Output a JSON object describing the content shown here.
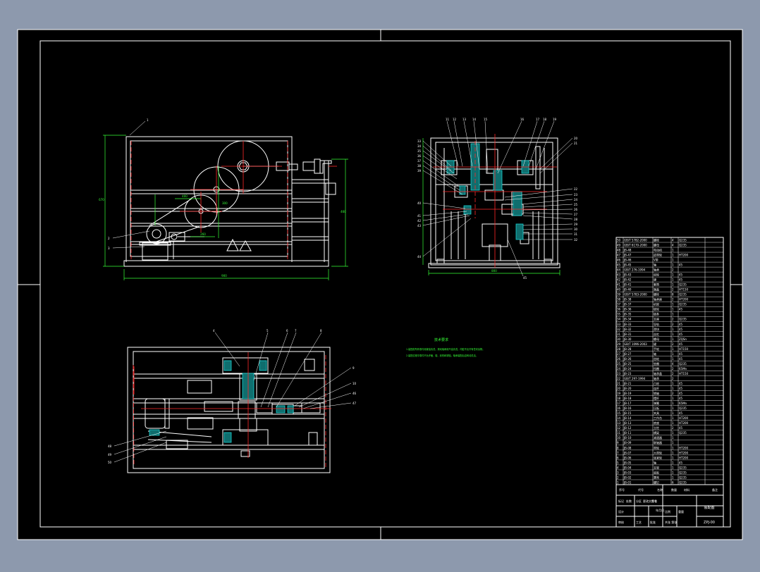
{
  "colors": {
    "background": "#8d99ad",
    "sheet": "#000000",
    "outline": "#ffffff",
    "dimension": "#37ff37",
    "centerline": "#ff2a2a",
    "section": "#19d3d3"
  },
  "front_view": {
    "overall_width": "900",
    "overall_height": "670",
    "side_height": "460",
    "dim_a": "400",
    "dim_b": "260",
    "dim_c": "300",
    "balloons": [
      "1",
      "2",
      "3"
    ]
  },
  "side_view": {
    "overall_width": "800",
    "top_balloons": [
      "11",
      "12",
      "13",
      "14",
      "15",
      "16",
      "17",
      "18",
      "19"
    ],
    "right_balloons": [
      "20",
      "21",
      "22",
      "23",
      "24",
      "25",
      "26",
      "27",
      "28",
      "29",
      "30",
      "31",
      "32"
    ],
    "left_balloons": [
      "33",
      "34",
      "35",
      "36",
      "37",
      "38",
      "39",
      "40",
      "41",
      "42",
      "43",
      "44"
    ],
    "bottom_balloon": "45"
  },
  "top_view": {
    "top_balloons": [
      "4",
      "5",
      "6",
      "7",
      "8"
    ],
    "right_balloons": [
      "9",
      "10",
      "46",
      "47"
    ],
    "left_balloons": [
      "48",
      "49",
      "50"
    ]
  },
  "technical_requirements": {
    "title": "技术要求",
    "line1": "1.装配前所有零件用煤油清洗，滚动轴承用汽油清洗，内腔不允许有任何杂物。",
    "line2": "2.装配过程中零件不允许磕、碰、划伤和锈蚀，轴承装配后应转动灵活。"
  },
  "bom": {
    "headers": [
      "序号",
      "代号",
      "名称",
      "数量",
      "材料",
      "备注"
    ],
    "rows": [
      [
        "50",
        "GB/T 5782-2000",
        "螺栓",
        "4",
        "Q235",
        ""
      ],
      [
        "49",
        "GB/T 6170-2000",
        "螺母",
        "4",
        "Q235",
        ""
      ],
      [
        "48",
        "JB-48",
        "电动机",
        "1",
        "",
        ""
      ],
      [
        "47",
        "JB-47",
        "皮带轮",
        "1",
        "HT200",
        ""
      ],
      [
        "46",
        "JB-46",
        "V带",
        "1",
        "",
        ""
      ],
      [
        "45",
        "JB-45",
        "轴",
        "1",
        "45",
        ""
      ],
      [
        "44",
        "GB/T 276-1994",
        "轴承",
        "2",
        "",
        ""
      ],
      [
        "43",
        "JB-43",
        "齿轮",
        "1",
        "45",
        ""
      ],
      [
        "42",
        "JB-42",
        "键",
        "1",
        "45",
        ""
      ],
      [
        "41",
        "JB-41",
        "套筒",
        "1",
        "Q235",
        ""
      ],
      [
        "40",
        "JB-40",
        "端盖",
        "2",
        "HT150",
        ""
      ],
      [
        "39",
        "GB/T 5783-2000",
        "螺栓",
        "8",
        "Q235",
        ""
      ],
      [
        "38",
        "JB-38",
        "轴承座",
        "2",
        "HT200",
        ""
      ],
      [
        "37",
        "JB-37",
        "机架",
        "1",
        "Q235",
        ""
      ],
      [
        "36",
        "JB-36",
        "链轮",
        "1",
        "45",
        ""
      ],
      [
        "35",
        "JB-35",
        "链条",
        "1",
        "",
        ""
      ],
      [
        "34",
        "JB-34",
        "支座",
        "2",
        "Q235",
        ""
      ],
      [
        "33",
        "JB-33",
        "导轨",
        "2",
        "45",
        ""
      ],
      [
        "32",
        "JB-32",
        "滑块",
        "1",
        "45",
        ""
      ],
      [
        "31",
        "JB-31",
        "丝杠",
        "1",
        "45",
        ""
      ],
      [
        "30",
        "JB-30",
        "螺母",
        "1",
        "ZQSn",
        ""
      ],
      [
        "29",
        "GB/T 1096-2003",
        "键",
        "2",
        "45",
        ""
      ],
      [
        "28",
        "JB-28",
        "手轮",
        "1",
        "HT150",
        ""
      ],
      [
        "27",
        "JB-27",
        "轴",
        "1",
        "45",
        ""
      ],
      [
        "26",
        "JB-26",
        "齿轮",
        "1",
        "45",
        ""
      ],
      [
        "25",
        "JB-25",
        "垫圈",
        "4",
        "Q235",
        ""
      ],
      [
        "24",
        "JB-24",
        "挡圈",
        "2",
        "65Mn",
        ""
      ],
      [
        "23",
        "JB-23",
        "轴承盖",
        "2",
        "HT150",
        ""
      ],
      [
        "22",
        "GB/T 297-1994",
        "轴承",
        "2",
        "",
        ""
      ],
      [
        "21",
        "JB-21",
        "凸轮",
        "1",
        "45",
        ""
      ],
      [
        "20",
        "JB-20",
        "连杆",
        "1",
        "45",
        ""
      ],
      [
        "19",
        "JB-19",
        "销轴",
        "2",
        "45",
        ""
      ],
      [
        "18",
        "JB-18",
        "摆杆",
        "1",
        "45",
        ""
      ],
      [
        "17",
        "JB-17",
        "弹簧",
        "1",
        "65Mn",
        ""
      ],
      [
        "16",
        "JB-16",
        "压板",
        "1",
        "Q235",
        ""
      ],
      [
        "15",
        "JB-15",
        "夹具",
        "1",
        "45",
        ""
      ],
      [
        "14",
        "JB-14",
        "工作台",
        "1",
        "HT200",
        ""
      ],
      [
        "13",
        "JB-13",
        "底座",
        "1",
        "HT200",
        ""
      ],
      [
        "12",
        "JB-12",
        "立柱",
        "2",
        "45",
        ""
      ],
      [
        "11",
        "JB-11",
        "横梁",
        "1",
        "Q235",
        ""
      ],
      [
        "10",
        "JB-10",
        "减速器",
        "1",
        "",
        ""
      ],
      [
        "9",
        "JB-09",
        "联轴器",
        "1",
        "",
        ""
      ],
      [
        "8",
        "JB-08",
        "带轮",
        "1",
        "HT200",
        ""
      ],
      [
        "7",
        "JB-07",
        "大带轮",
        "1",
        "HT200",
        ""
      ],
      [
        "6",
        "JB-06",
        "张紧轮",
        "1",
        "HT200",
        ""
      ],
      [
        "5",
        "JB-05",
        "轴",
        "1",
        "45",
        ""
      ],
      [
        "4",
        "JB-04",
        "支架",
        "1",
        "Q235",
        ""
      ],
      [
        "3",
        "JB-03",
        "底板",
        "1",
        "Q235",
        ""
      ],
      [
        "2",
        "JB-02",
        "罩壳",
        "1",
        "Q235",
        ""
      ],
      [
        "1",
        "JB-01",
        "螺钉",
        "6",
        "Q235",
        ""
      ]
    ]
  },
  "title_block": {
    "drawing_title": "装配图",
    "drawing_number": "ZPJ-00",
    "labels": [
      "标记",
      "处数",
      "分区",
      "更改文件号",
      "签名",
      "年月日"
    ],
    "roles": [
      "设计",
      "审核",
      "工艺",
      "批准"
    ],
    "scale_label": "比例",
    "weight_label": "重量",
    "sheet_label": "共张 第张"
  }
}
